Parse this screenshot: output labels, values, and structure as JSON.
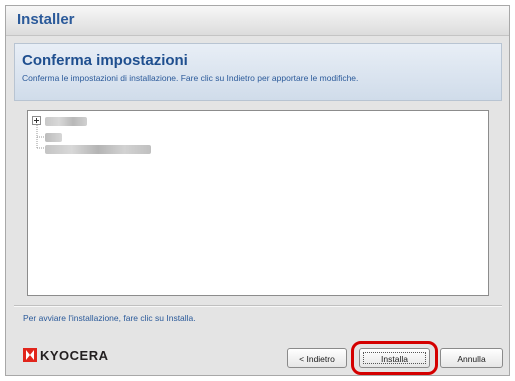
{
  "window": {
    "title": "Installer"
  },
  "header": {
    "title": "Conferma impostazioni",
    "subtitle": "Conferma le impostazioni di installazione. Fare clic su Indietro per apportare le modifiche."
  },
  "settings_tree": {
    "expander_glyph": "⊞",
    "items": [
      {
        "label": "",
        "level": 0,
        "redacted": true
      },
      {
        "label": "",
        "level": 1,
        "redacted": true
      },
      {
        "label": "",
        "level": 1,
        "redacted": true
      }
    ]
  },
  "footer": {
    "instruction": "Per avviare l'installazione, fare clic su Installa."
  },
  "logo": {
    "text": "KYOCERA",
    "mark_color": "#e1251b"
  },
  "buttons": {
    "back_label": "< Indietro",
    "install_label": "Installa",
    "cancel_label": "Annulla"
  },
  "annotation": {
    "highlight_target": "install-button",
    "color": "#d40000"
  },
  "colors": {
    "title_blue": "#2b5a9a",
    "header_bg": "#d0dcea"
  }
}
